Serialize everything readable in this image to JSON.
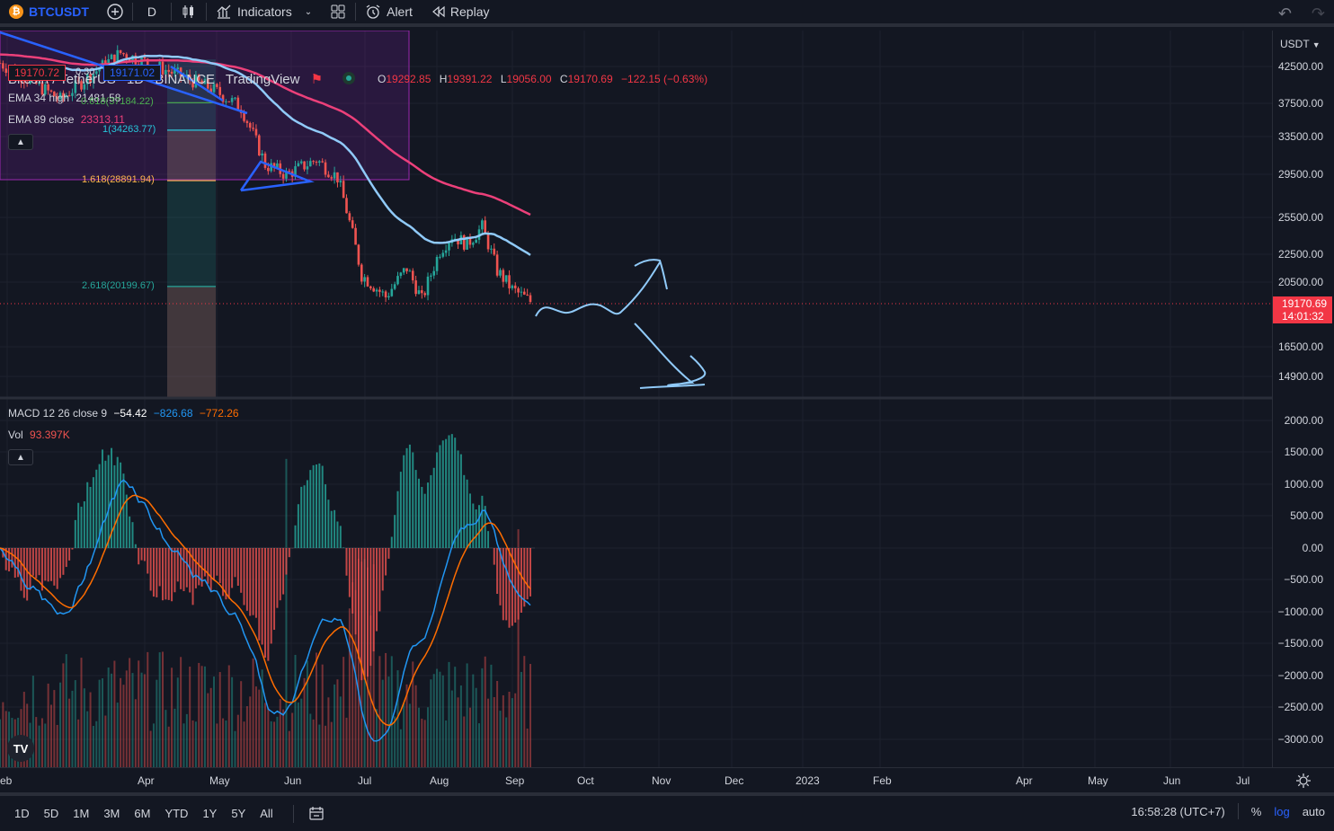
{
  "toolbar": {
    "symbol": "BTCUSDT",
    "btc_icon": "₿",
    "interval": "D",
    "indicators_label": "Indicators",
    "alert_label": "Alert",
    "replay_label": "Replay"
  },
  "legend": {
    "pair": "Bitcoin / TetherUS",
    "interval": "1D",
    "exchange": "BINANCE",
    "source": "TradingView",
    "ohlc": {
      "o_key": "O",
      "o": "19292.85",
      "h_key": "H",
      "h": "19391.22",
      "l_key": "L",
      "l": "19056.00",
      "c_key": "C",
      "c": "19170.69",
      "chg": "−122.15 (−0.63%)"
    },
    "bid": "19170.72",
    "spread": "0.30",
    "ask": "19171.02",
    "ema34_label": "EMA 34 high",
    "ema34_value": "21481.58",
    "ema89_label": "EMA 89 close",
    "ema89_value": "23313.11",
    "macd_label": "MACD 12 26 close 9",
    "macd_hist": "−54.42",
    "macd_line": "−826.68",
    "macd_signal": "−772.26",
    "vol_label": "Vol",
    "vol_value": "93.397K"
  },
  "fib_levels": [
    {
      "label": "0.618(37184.22)",
      "color": "#4caf50",
      "price": 37600
    },
    {
      "label": "1(34263.77)",
      "color": "#26c6da",
      "price": 34263
    },
    {
      "label": "1.618(28891.94)",
      "color": "#ffb74d",
      "price": 28891
    },
    {
      "label": "2.618(20199.67)",
      "color": "#26a69a",
      "price": 20199
    }
  ],
  "price_axis": {
    "currency": "USDT",
    "labels": [
      "42500.00",
      "37500.00",
      "33500.00",
      "29500.00",
      "25500.00",
      "22500.00",
      "20500.00",
      "16500.00",
      "14900.00"
    ],
    "last_price": "19170.69",
    "countdown": "14:01:32"
  },
  "macd_axis": {
    "labels": [
      "2000.00",
      "1500.00",
      "1000.00",
      "500.00",
      "0.00",
      "−500.00",
      "−1000.00",
      "−1500.00",
      "−2000.00",
      "−2500.00",
      "−3000.00"
    ]
  },
  "time_axis": {
    "labels": [
      "eb",
      "Apr",
      "May",
      "Jun",
      "Jul",
      "Aug",
      "Sep",
      "Oct",
      "Nov",
      "Dec",
      "2023",
      "Feb",
      "Apr",
      "May",
      "Jun",
      "Jul"
    ]
  },
  "bottom_bar": {
    "ranges": [
      "1D",
      "5D",
      "1M",
      "3M",
      "6M",
      "YTD",
      "1Y",
      "5Y",
      "All"
    ],
    "clock": "16:58:28 (UTC+7)",
    "percent": "%",
    "log": "log",
    "auto": "auto"
  },
  "logo_text": "TV",
  "colors": {
    "up": "#26a69a",
    "down": "#ef5350",
    "ema34": "#90caf9",
    "ema89": "#ec407a",
    "macd": "#2196f3",
    "signal": "#ff6d00",
    "accent": "#2962ff"
  }
}
